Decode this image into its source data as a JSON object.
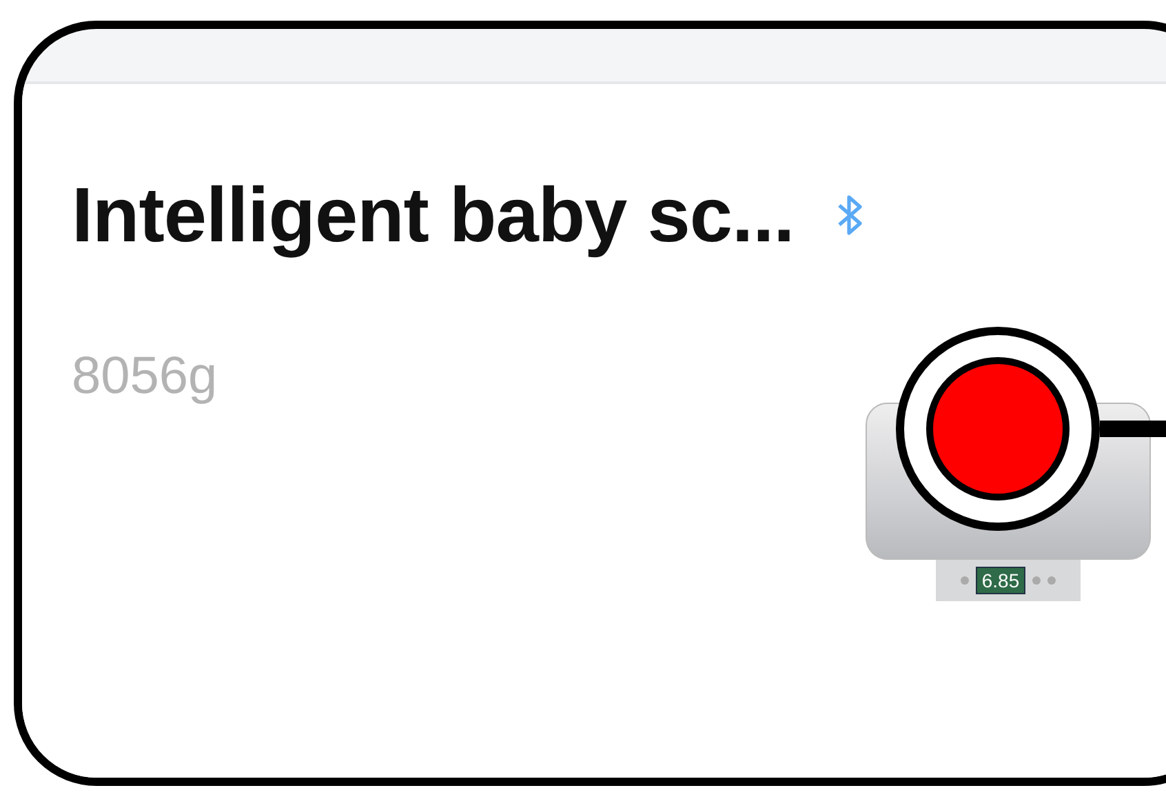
{
  "device": {
    "name": "Intelligent baby sc...",
    "bluetooth": true,
    "weight": "8056g",
    "scale_display": "6.85"
  }
}
